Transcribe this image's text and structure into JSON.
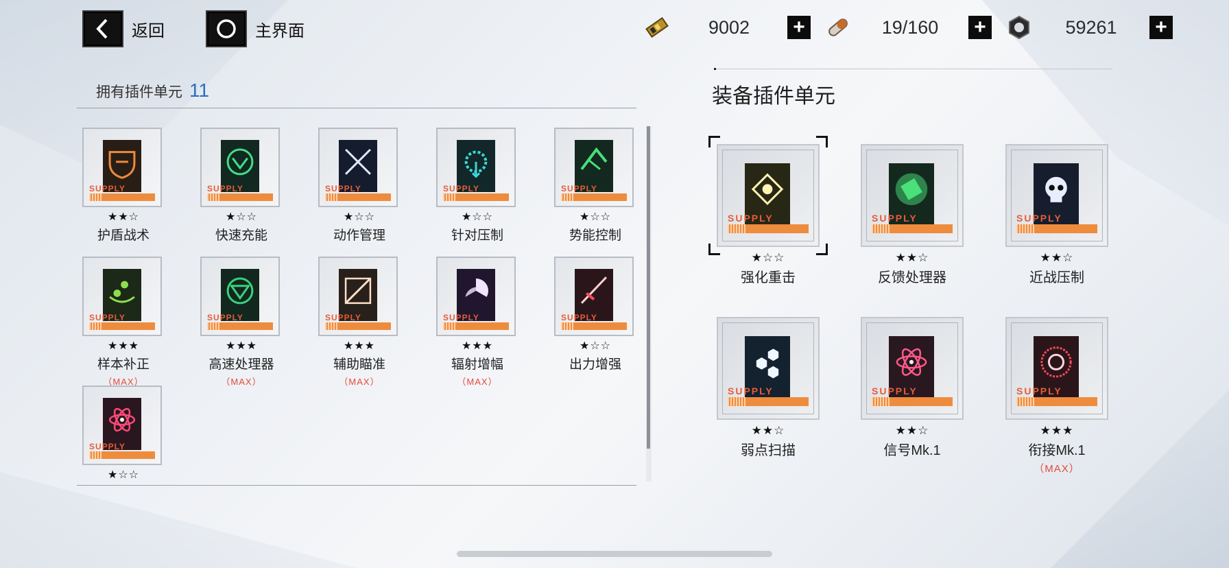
{
  "top": {
    "back_label": "返回",
    "home_label": "主界面",
    "currencies": [
      {
        "icon": "battery-cell-icon",
        "value": "9002"
      },
      {
        "icon": "capsule-icon",
        "value": "19/160"
      },
      {
        "icon": "gear-nut-icon",
        "value": "59261"
      }
    ],
    "plus_label": "+"
  },
  "owned": {
    "label": "拥有插件单元",
    "count": "11",
    "supply_label": "SUPPLY",
    "items": [
      {
        "name": "护盾战术",
        "stars": "★★☆",
        "max": "",
        "color": "#f08a3c",
        "icon": "shield-icon"
      },
      {
        "name": "快速充能",
        "stars": "★☆☆",
        "max": "",
        "color": "#3fe08a",
        "icon": "recharge-icon"
      },
      {
        "name": "动作管理",
        "stars": "★☆☆",
        "max": "",
        "color": "#4a7cff",
        "icon": "crossed-swords-icon"
      },
      {
        "name": "针对压制",
        "stars": "★☆☆",
        "max": "",
        "color": "#3ad8d8",
        "icon": "gear-arrow-icon"
      },
      {
        "name": "势能控制",
        "stars": "★☆☆",
        "max": "",
        "color": "#44e07a",
        "icon": "momentum-icon"
      },
      {
        "name": "样本补正",
        "stars": "★★★",
        "max": "（MAX）",
        "color": "#8ee04a",
        "icon": "sample-icon"
      },
      {
        "name": "高速处理器",
        "stars": "★★★",
        "max": "（MAX）",
        "color": "#38d27c",
        "icon": "processor-icon"
      },
      {
        "name": "辅助瞄准",
        "stars": "★★★",
        "max": "（MAX）",
        "color": "#f0a060",
        "icon": "aim-icon"
      },
      {
        "name": "辐射增幅",
        "stars": "★★★",
        "max": "（MAX）",
        "color": "#b04aff",
        "icon": "radiation-icon"
      },
      {
        "name": "出力增强",
        "stars": "★☆☆",
        "max": "",
        "color": "#ff4a5a",
        "icon": "blade-icon"
      },
      {
        "name": "",
        "stars": "★☆☆",
        "max": "",
        "color": "#ff4a7a",
        "icon": "atom-icon"
      }
    ]
  },
  "equipped": {
    "title": "装备插件单元",
    "items": [
      {
        "name": "强化重击",
        "stars": "★☆☆",
        "max": "",
        "color": "#f2d23a",
        "icon": "claw-icon",
        "selected": true
      },
      {
        "name": "反馈处理器",
        "stars": "★★☆",
        "max": "",
        "color": "#4ae07a",
        "icon": "fist-icon",
        "selected": false
      },
      {
        "name": "近战压制",
        "stars": "★★☆",
        "max": "",
        "color": "#5a8cff",
        "icon": "skull-icon",
        "selected": false
      },
      {
        "name": "弱点扫描",
        "stars": "★★☆",
        "max": "",
        "color": "#4aa8ff",
        "icon": "hexagon-icon",
        "selected": false
      },
      {
        "name": "信号Mk.1",
        "stars": "★★☆",
        "max": "",
        "color": "#ff5a8a",
        "icon": "atom-icon",
        "selected": false
      },
      {
        "name": "衔接Mk.1",
        "stars": "★★★",
        "max": "（MAX）",
        "color": "#ff4a5a",
        "icon": "burst-icon",
        "selected": false
      }
    ]
  }
}
